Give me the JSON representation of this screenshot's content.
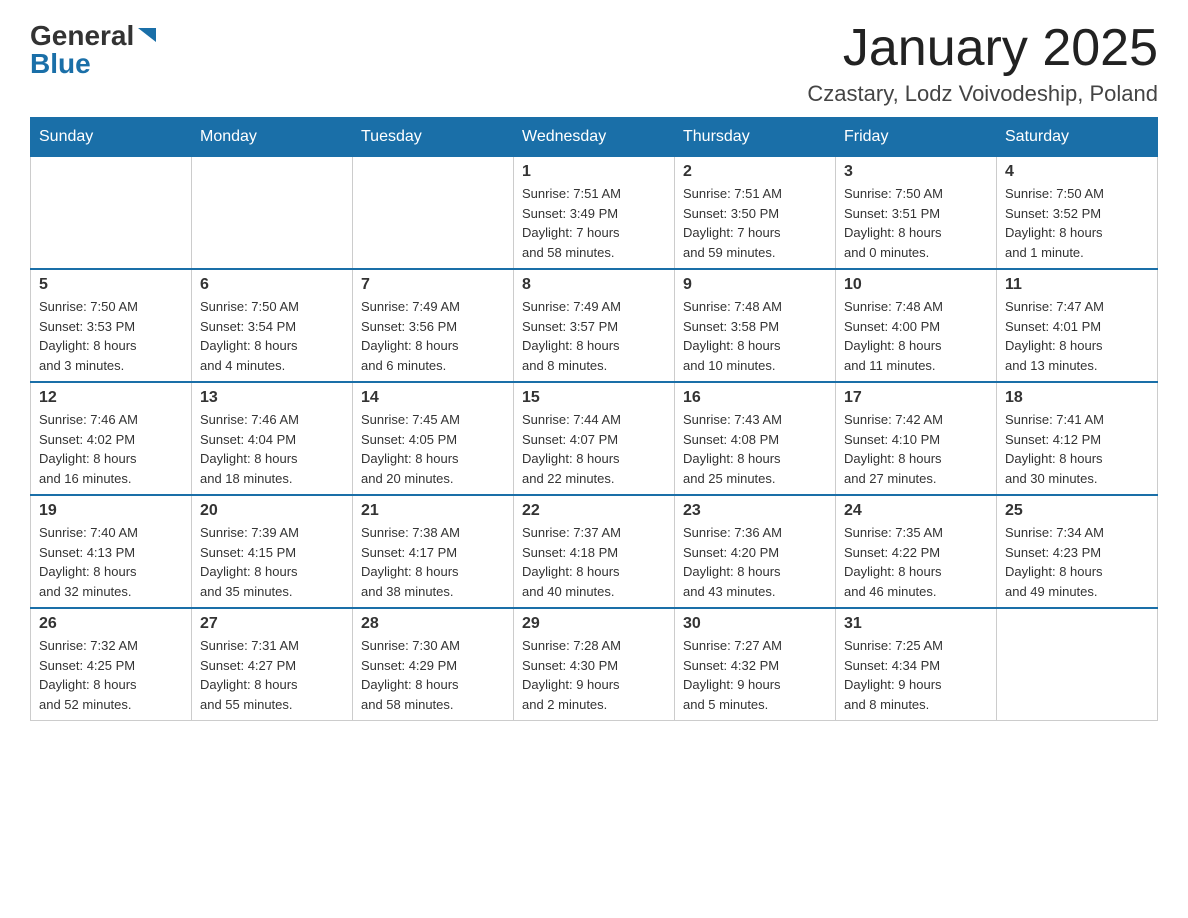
{
  "header": {
    "logo": {
      "general": "General",
      "blue": "Blue"
    },
    "title": "January 2025",
    "location": "Czastary, Lodz Voivodeship, Poland"
  },
  "days_of_week": [
    "Sunday",
    "Monday",
    "Tuesday",
    "Wednesday",
    "Thursday",
    "Friday",
    "Saturday"
  ],
  "weeks": [
    [
      {
        "day": "",
        "info": ""
      },
      {
        "day": "",
        "info": ""
      },
      {
        "day": "",
        "info": ""
      },
      {
        "day": "1",
        "info": "Sunrise: 7:51 AM\nSunset: 3:49 PM\nDaylight: 7 hours\nand 58 minutes."
      },
      {
        "day": "2",
        "info": "Sunrise: 7:51 AM\nSunset: 3:50 PM\nDaylight: 7 hours\nand 59 minutes."
      },
      {
        "day": "3",
        "info": "Sunrise: 7:50 AM\nSunset: 3:51 PM\nDaylight: 8 hours\nand 0 minutes."
      },
      {
        "day": "4",
        "info": "Sunrise: 7:50 AM\nSunset: 3:52 PM\nDaylight: 8 hours\nand 1 minute."
      }
    ],
    [
      {
        "day": "5",
        "info": "Sunrise: 7:50 AM\nSunset: 3:53 PM\nDaylight: 8 hours\nand 3 minutes."
      },
      {
        "day": "6",
        "info": "Sunrise: 7:50 AM\nSunset: 3:54 PM\nDaylight: 8 hours\nand 4 minutes."
      },
      {
        "day": "7",
        "info": "Sunrise: 7:49 AM\nSunset: 3:56 PM\nDaylight: 8 hours\nand 6 minutes."
      },
      {
        "day": "8",
        "info": "Sunrise: 7:49 AM\nSunset: 3:57 PM\nDaylight: 8 hours\nand 8 minutes."
      },
      {
        "day": "9",
        "info": "Sunrise: 7:48 AM\nSunset: 3:58 PM\nDaylight: 8 hours\nand 10 minutes."
      },
      {
        "day": "10",
        "info": "Sunrise: 7:48 AM\nSunset: 4:00 PM\nDaylight: 8 hours\nand 11 minutes."
      },
      {
        "day": "11",
        "info": "Sunrise: 7:47 AM\nSunset: 4:01 PM\nDaylight: 8 hours\nand 13 minutes."
      }
    ],
    [
      {
        "day": "12",
        "info": "Sunrise: 7:46 AM\nSunset: 4:02 PM\nDaylight: 8 hours\nand 16 minutes."
      },
      {
        "day": "13",
        "info": "Sunrise: 7:46 AM\nSunset: 4:04 PM\nDaylight: 8 hours\nand 18 minutes."
      },
      {
        "day": "14",
        "info": "Sunrise: 7:45 AM\nSunset: 4:05 PM\nDaylight: 8 hours\nand 20 minutes."
      },
      {
        "day": "15",
        "info": "Sunrise: 7:44 AM\nSunset: 4:07 PM\nDaylight: 8 hours\nand 22 minutes."
      },
      {
        "day": "16",
        "info": "Sunrise: 7:43 AM\nSunset: 4:08 PM\nDaylight: 8 hours\nand 25 minutes."
      },
      {
        "day": "17",
        "info": "Sunrise: 7:42 AM\nSunset: 4:10 PM\nDaylight: 8 hours\nand 27 minutes."
      },
      {
        "day": "18",
        "info": "Sunrise: 7:41 AM\nSunset: 4:12 PM\nDaylight: 8 hours\nand 30 minutes."
      }
    ],
    [
      {
        "day": "19",
        "info": "Sunrise: 7:40 AM\nSunset: 4:13 PM\nDaylight: 8 hours\nand 32 minutes."
      },
      {
        "day": "20",
        "info": "Sunrise: 7:39 AM\nSunset: 4:15 PM\nDaylight: 8 hours\nand 35 minutes."
      },
      {
        "day": "21",
        "info": "Sunrise: 7:38 AM\nSunset: 4:17 PM\nDaylight: 8 hours\nand 38 minutes."
      },
      {
        "day": "22",
        "info": "Sunrise: 7:37 AM\nSunset: 4:18 PM\nDaylight: 8 hours\nand 40 minutes."
      },
      {
        "day": "23",
        "info": "Sunrise: 7:36 AM\nSunset: 4:20 PM\nDaylight: 8 hours\nand 43 minutes."
      },
      {
        "day": "24",
        "info": "Sunrise: 7:35 AM\nSunset: 4:22 PM\nDaylight: 8 hours\nand 46 minutes."
      },
      {
        "day": "25",
        "info": "Sunrise: 7:34 AM\nSunset: 4:23 PM\nDaylight: 8 hours\nand 49 minutes."
      }
    ],
    [
      {
        "day": "26",
        "info": "Sunrise: 7:32 AM\nSunset: 4:25 PM\nDaylight: 8 hours\nand 52 minutes."
      },
      {
        "day": "27",
        "info": "Sunrise: 7:31 AM\nSunset: 4:27 PM\nDaylight: 8 hours\nand 55 minutes."
      },
      {
        "day": "28",
        "info": "Sunrise: 7:30 AM\nSunset: 4:29 PM\nDaylight: 8 hours\nand 58 minutes."
      },
      {
        "day": "29",
        "info": "Sunrise: 7:28 AM\nSunset: 4:30 PM\nDaylight: 9 hours\nand 2 minutes."
      },
      {
        "day": "30",
        "info": "Sunrise: 7:27 AM\nSunset: 4:32 PM\nDaylight: 9 hours\nand 5 minutes."
      },
      {
        "day": "31",
        "info": "Sunrise: 7:25 AM\nSunset: 4:34 PM\nDaylight: 9 hours\nand 8 minutes."
      },
      {
        "day": "",
        "info": ""
      }
    ]
  ]
}
